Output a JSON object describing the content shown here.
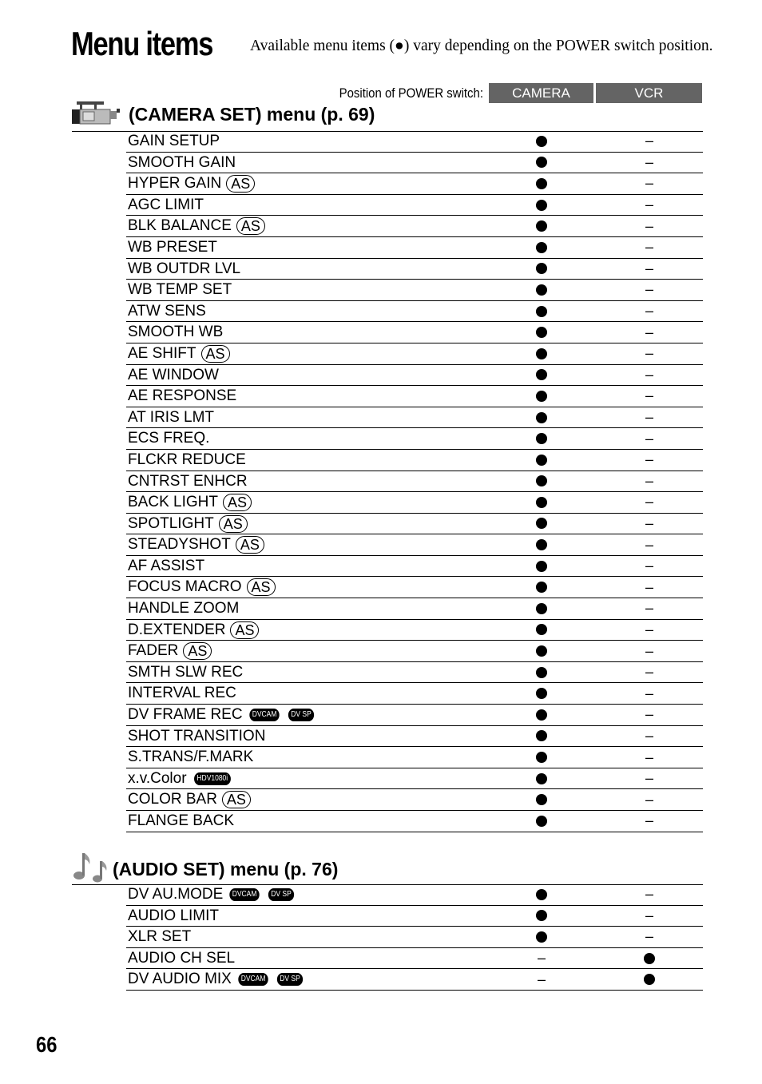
{
  "title": "Menu items",
  "intro": "Available menu items (●) vary depending on the POWER switch position.",
  "power_switch": {
    "label": "Position of POWER switch:",
    "columns": [
      "CAMERA",
      "VCR"
    ]
  },
  "sections": [
    {
      "icon": "camera-icon",
      "heading": "(CAMERA SET) menu (p. 69)",
      "items": [
        {
          "name": "GAIN SETUP",
          "tags": [],
          "camera": "dot",
          "vcr": "–"
        },
        {
          "name": "SMOOTH GAIN",
          "tags": [],
          "camera": "dot",
          "vcr": "–"
        },
        {
          "name": "HYPER GAIN",
          "tags": [
            "AS"
          ],
          "camera": "dot",
          "vcr": "–"
        },
        {
          "name": "AGC LIMIT",
          "tags": [],
          "camera": "dot",
          "vcr": "–"
        },
        {
          "name": "BLK BALANCE",
          "tags": [
            "AS"
          ],
          "camera": "dot",
          "vcr": "–"
        },
        {
          "name": "WB PRESET",
          "tags": [],
          "camera": "dot",
          "vcr": "–"
        },
        {
          "name": "WB OUTDR LVL",
          "tags": [],
          "camera": "dot",
          "vcr": "–"
        },
        {
          "name": "WB TEMP SET",
          "tags": [],
          "camera": "dot",
          "vcr": "–"
        },
        {
          "name": "ATW SENS",
          "tags": [],
          "camera": "dot",
          "vcr": "–"
        },
        {
          "name": "SMOOTH WB",
          "tags": [],
          "camera": "dot",
          "vcr": "–"
        },
        {
          "name": "AE SHIFT",
          "tags": [
            "AS"
          ],
          "camera": "dot",
          "vcr": "–"
        },
        {
          "name": "AE WINDOW",
          "tags": [],
          "camera": "dot",
          "vcr": "–"
        },
        {
          "name": "AE RESPONSE",
          "tags": [],
          "camera": "dot",
          "vcr": "–"
        },
        {
          "name": "AT IRIS LMT",
          "tags": [],
          "camera": "dot",
          "vcr": "–"
        },
        {
          "name": "ECS FREQ.",
          "tags": [],
          "camera": "dot",
          "vcr": "–"
        },
        {
          "name": "FLCKR REDUCE",
          "tags": [],
          "camera": "dot",
          "vcr": "–"
        },
        {
          "name": "CNTRST ENHCR",
          "tags": [],
          "camera": "dot",
          "vcr": "–"
        },
        {
          "name": "BACK LIGHT",
          "tags": [
            "AS"
          ],
          "camera": "dot",
          "vcr": "–"
        },
        {
          "name": "SPOTLIGHT",
          "tags": [
            "AS"
          ],
          "camera": "dot",
          "vcr": "–"
        },
        {
          "name": "STEADYSHOT",
          "tags": [
            "AS"
          ],
          "camera": "dot",
          "vcr": "–"
        },
        {
          "name": "AF ASSIST",
          "tags": [],
          "camera": "dot",
          "vcr": "–"
        },
        {
          "name": "FOCUS MACRO",
          "tags": [
            "AS"
          ],
          "camera": "dot",
          "vcr": "–"
        },
        {
          "name": "HANDLE ZOOM",
          "tags": [],
          "camera": "dot",
          "vcr": "–"
        },
        {
          "name": "D.EXTENDER",
          "tags": [
            "AS"
          ],
          "camera": "dot",
          "vcr": "–"
        },
        {
          "name": "FADER",
          "tags": [
            "AS"
          ],
          "camera": "dot",
          "vcr": "–"
        },
        {
          "name": "SMTH SLW REC",
          "tags": [],
          "camera": "dot",
          "vcr": "–"
        },
        {
          "name": "INTERVAL REC",
          "tags": [],
          "camera": "dot",
          "vcr": "–"
        },
        {
          "name": "DV FRAME REC",
          "tags": [
            "DVCAM",
            "DV SP"
          ],
          "camera": "dot",
          "vcr": "–"
        },
        {
          "name": "SHOT TRANSITION",
          "tags": [],
          "camera": "dot",
          "vcr": "–"
        },
        {
          "name": "S.TRANS/F.MARK",
          "tags": [],
          "camera": "dot",
          "vcr": "–"
        },
        {
          "name": "x.v.Color",
          "tags": [
            "HDV1080i"
          ],
          "camera": "dot",
          "vcr": "–"
        },
        {
          "name": "COLOR BAR",
          "tags": [
            "AS"
          ],
          "camera": "dot",
          "vcr": "–"
        },
        {
          "name": "FLANGE BACK",
          "tags": [],
          "camera": "dot",
          "vcr": "–"
        }
      ]
    },
    {
      "icon": "music-notes-icon",
      "heading": "(AUDIO SET) menu (p. 76)",
      "items": [
        {
          "name": "DV AU.MODE",
          "tags": [
            "DVCAM",
            "DV SP"
          ],
          "camera": "dot",
          "vcr": "–"
        },
        {
          "name": "AUDIO LIMIT",
          "tags": [],
          "camera": "dot",
          "vcr": "–"
        },
        {
          "name": "XLR SET",
          "tags": [],
          "camera": "dot",
          "vcr": "–"
        },
        {
          "name": "AUDIO CH SEL",
          "tags": [],
          "camera": "–",
          "vcr": "dot"
        },
        {
          "name": "DV AUDIO MIX",
          "tags": [
            "DVCAM",
            "DV SP"
          ],
          "camera": "–",
          "vcr": "dot"
        }
      ]
    }
  ],
  "page_number": "66"
}
